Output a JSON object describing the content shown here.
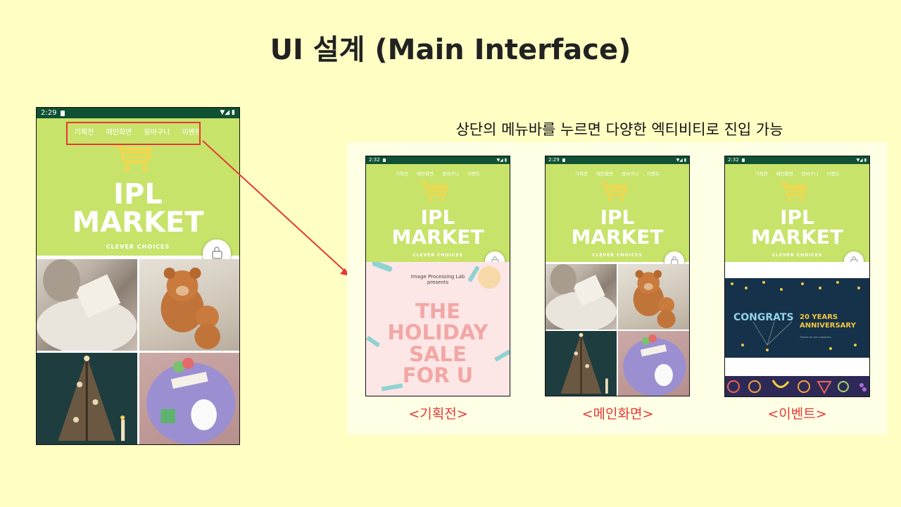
{
  "slide_title": "UI 설계 (Main Interface)",
  "subtitle": "상단의 메뉴바를 누르면 다양한 엑티비티로 진입 가능",
  "colors": {
    "background": "#FFFFC4",
    "panel": "#FFFFE6",
    "status_bar": "#0F5132",
    "header_green": "#C7E36A",
    "cart_yellow": "#F6D54A",
    "highlight_red": "#E53935"
  },
  "app": {
    "menu": [
      "기획전",
      "메인화면",
      "장바구니",
      "이벤트"
    ],
    "brand_line1": "IPL",
    "brand_line2": "MARKET",
    "tagline": "CLEVER CHOICES",
    "logo_icon": "shopping-cart-icon",
    "cart_button_icon": "shopping-bag-icon"
  },
  "main_phone": {
    "time": "2:29"
  },
  "screens": [
    {
      "time": "2:32",
      "caption": "<기획전>"
    },
    {
      "time": "2:29",
      "caption": "<메인화면>"
    },
    {
      "time": "2:32",
      "caption": "<이벤트>"
    }
  ],
  "holiday": {
    "presenter_line1": "Image Processing Lab",
    "presenter_line2": "presents",
    "lines": [
      "THE",
      "HOLIDAY",
      "SALE",
      "FOR U"
    ]
  },
  "event": {
    "congrats": "CONGRATS",
    "years_line1": "20 YEARS",
    "years_line2": "ANNIVERSARY",
    "thanks": "Thanks for our customers"
  }
}
